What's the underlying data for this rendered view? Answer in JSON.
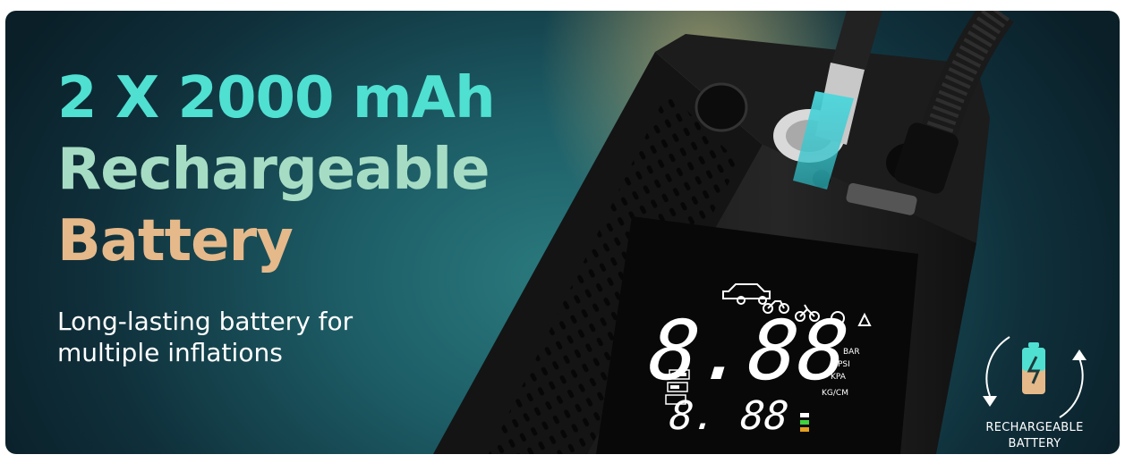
{
  "headline": {
    "line1": "2 X 2000 mAh",
    "line2": "Rechargeable",
    "line3": "Battery"
  },
  "subtitle": {
    "line1": "Long-lasting battery for",
    "line2": "multiple inflations"
  },
  "display": {
    "main_digits": "8.88",
    "small_digits": "8. 88",
    "units": [
      "BAR",
      "PSI",
      "KPA",
      "KG/CM"
    ]
  },
  "badge": {
    "line1": "RECHARGEABLE",
    "line2": "BATTERY",
    "icon": "recharge-cycle-icon"
  },
  "colors": {
    "headline_teal": "#4fe0d2",
    "headline_mint": "#a6dcc4",
    "headline_peach": "#e5b98a",
    "background_teal": "#1d5d66",
    "background_dark": "#0a1f28"
  }
}
